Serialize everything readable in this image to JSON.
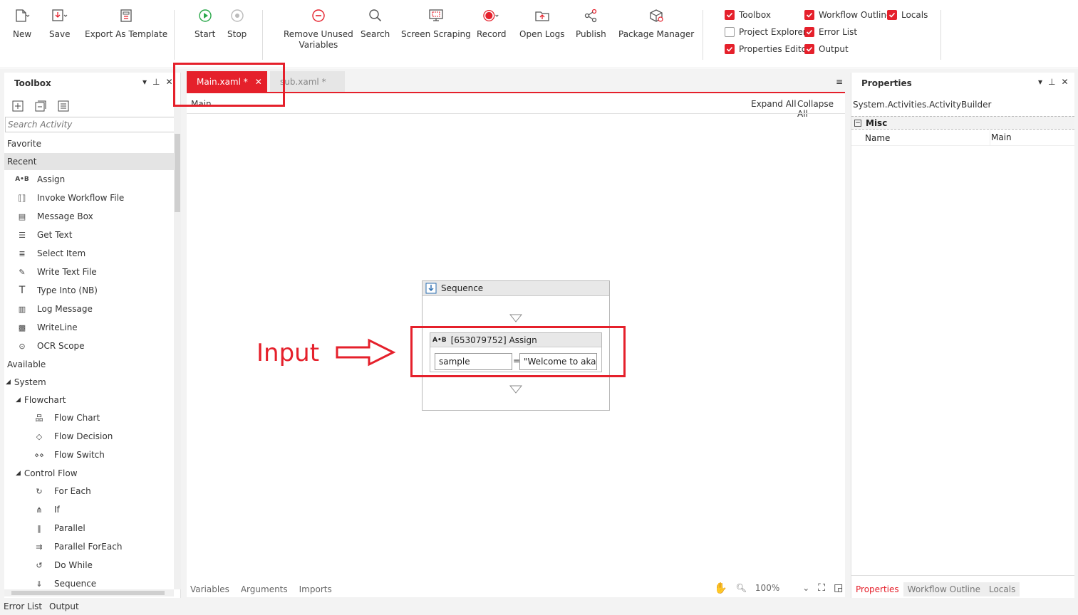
{
  "ribbon": {
    "new": "New",
    "save": "Save",
    "export_template": "Export As Template",
    "start": "Start",
    "stop": "Stop",
    "remove_unused_1": "Remove Unused",
    "remove_unused_2": "Variables",
    "search": "Search",
    "screen_scraping": "Screen Scraping",
    "record": "Record",
    "open_logs": "Open Logs",
    "publish": "Publish",
    "package_manager": "Package Manager",
    "checks": {
      "toolbox": "Toolbox",
      "workflow_outline": "Workflow Outline",
      "locals": "Locals",
      "project_explorer": "Project Explorer",
      "error_list": "Error List",
      "properties_editor": "Properties Editor",
      "output": "Output"
    },
    "check_states": {
      "toolbox": true,
      "workflow_outline": true,
      "locals": true,
      "project_explorer": false,
      "error_list": true,
      "properties_editor": true,
      "output": true
    }
  },
  "toolbox": {
    "title": "Toolbox",
    "search_placeholder": "Search Activity",
    "favorite": "Favorite",
    "recent": "Recent",
    "recent_items": [
      "Assign",
      "Invoke Workflow File",
      "Message Box",
      "Get Text",
      "Select Item",
      "Write Text File",
      "Type Into (NB)",
      "Log Message",
      "WriteLine",
      "OCR Scope"
    ],
    "available": "Available",
    "system": "System",
    "flowchart": "Flowchart",
    "flowchart_items": [
      "Flow Chart",
      "Flow Decision",
      "Flow Switch"
    ],
    "control_flow": "Control Flow",
    "control_flow_items": [
      "For Each",
      "If",
      "Parallel",
      "Parallel ForEach",
      "Do While",
      "Sequence"
    ]
  },
  "tabs": {
    "main": "Main.xaml *",
    "sub": "sub.xaml *"
  },
  "designer": {
    "breadcrumb": "Main",
    "expand_all": "Expand All",
    "collapse_all": "Collapse All",
    "sequence_title": "Sequence",
    "assign_title": "[653079752] Assign",
    "assign_to": "sample",
    "assign_eq": "=",
    "assign_value": "\"Welcome to akaB",
    "annotation": "Input",
    "bottom_tabs": [
      "Variables",
      "Arguments",
      "Imports"
    ],
    "zoom": "100%"
  },
  "properties": {
    "title": "Properties",
    "type": "System.Activities.ActivityBuilder",
    "category": "Misc",
    "name_label": "Name",
    "name_value": "Main",
    "bottom_tabs": [
      "Properties",
      "Workflow Outline",
      "Locals"
    ]
  },
  "statusbar": {
    "error_list": "Error List",
    "output": "Output"
  },
  "colors": {
    "accent": "#e5202b",
    "play": "#2aa84a"
  }
}
